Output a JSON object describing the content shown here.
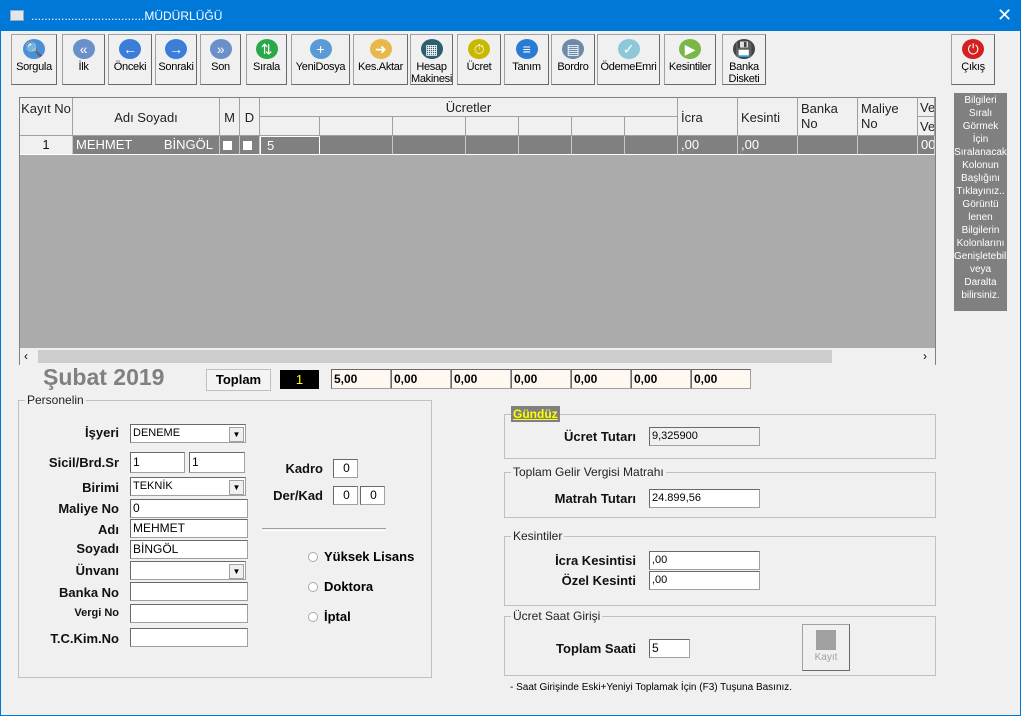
{
  "window": {
    "title": "..................................MÜDÜRLÜĞÜ",
    "close": "✕"
  },
  "toolbar": [
    {
      "label": "Sorgula",
      "icon": "search-icon",
      "glyph": "🔍",
      "color": "#4a90d9"
    },
    {
      "label": "İlk",
      "icon": "first-icon",
      "glyph": "«",
      "color": "#6b8fc9"
    },
    {
      "label": "Önceki",
      "icon": "previous-icon",
      "glyph": "←",
      "color": "#3b7dd8"
    },
    {
      "label": "Sonraki",
      "icon": "next-icon",
      "glyph": "→",
      "color": "#3b7dd8"
    },
    {
      "label": "Son",
      "icon": "last-icon",
      "glyph": "»",
      "color": "#6b8fc9"
    },
    {
      "label": "Sırala",
      "icon": "sort-icon",
      "glyph": "⇅",
      "color": "#2aa84a"
    },
    {
      "label": "YeniDosya",
      "icon": "new-folder-icon",
      "glyph": "+",
      "color": "#5b9bd5"
    },
    {
      "label": "Kes.Aktar",
      "icon": "folder-export-icon",
      "glyph": "➜",
      "color": "#e8b84a"
    },
    {
      "label": "Hesap Makinesi",
      "icon": "calculator-icon",
      "glyph": "▦",
      "color": "#2f5f6f"
    },
    {
      "label": "Ücret",
      "icon": "stopwatch-icon",
      "glyph": "⏱",
      "color": "#c9b800"
    },
    {
      "label": "Tanım",
      "icon": "definition-icon",
      "glyph": "≡",
      "color": "#2a7bd4"
    },
    {
      "label": "Bordro",
      "icon": "payroll-icon",
      "glyph": "▤",
      "color": "#6d8aa8"
    },
    {
      "label": "ÖdemeEmri",
      "icon": "payment-order-icon",
      "glyph": "✓",
      "color": "#8ec8d8"
    },
    {
      "label": "Kesintiler",
      "icon": "deductions-icon",
      "glyph": "▶",
      "color": "#7ab648"
    },
    {
      "label": "Banka Disketi",
      "icon": "floppy-disk-icon",
      "glyph": "💾",
      "color": "#444444"
    },
    {
      "label": "Çıkış",
      "icon": "power-icon",
      "glyph": "⏻",
      "color": "#d42020"
    }
  ],
  "grid": {
    "headers": {
      "kayit": "Kayıt No",
      "adi": "Adı Soyadı",
      "m": "M",
      "d": "D",
      "ucretler": "Ücretler",
      "icra": "İcra",
      "kesinti": "Kesinti",
      "banka": "Banka No",
      "maliye": "Maliye No",
      "ve1": "Ve",
      "ve2": "Ve"
    },
    "rows": [
      {
        "kayit": "1",
        "ad": "MEHMET",
        "soyad": "BİNGÖL",
        "ucret1": "5",
        "icra": ",00",
        "kesinti": ",00",
        "ve": "00"
      }
    ]
  },
  "side_info": "Bilgileri Sıralı Görmek İçin Sıralanacak Kolonun Başlığını Tıklayınız.. Görüntü lenen Bilgilerin Kolonlarını Genişletebili veya Daralta bilirsiniz.",
  "period": "Şubat  2019",
  "totals": {
    "label": "Toplam",
    "count": "1",
    "values": [
      "5,00",
      "0,00",
      "0,00",
      "0,00",
      "0,00",
      "0,00",
      "0,00"
    ]
  },
  "personel": {
    "legend": "Personelin",
    "isyeri_label": "İşyeri",
    "isyeri": "DENEME",
    "sicil_label": "Sicil/Brd.Sr",
    "sicil": "1",
    "brd": "1",
    "birimi_label": "Birimi",
    "birimi": "TEKNİK",
    "maliye_label": "Maliye No",
    "maliye": "0",
    "adi_label": "Adı",
    "adi": "MEHMET",
    "soyadi_label": "Soyadı",
    "soyadi": "BİNGÖL",
    "unvani_label": "Ünvanı",
    "unvani": "",
    "banka_label": "Banka No",
    "banka": "",
    "vergi_label": "Vergi No",
    "vergi": "",
    "tc_label": "T.C.Kim.No",
    "tc": "",
    "kadro_label": "Kadro",
    "kadro": "0",
    "derkad_label": "Der/Kad",
    "der": "0",
    "kad": "0",
    "radios": [
      "Yüksek Lisans",
      "Doktora",
      "İptal"
    ]
  },
  "gunduz": {
    "legend": "Gündüz",
    "label": "Ücret Tutarı",
    "value": "9,325900"
  },
  "matrah": {
    "legend": "Toplam Gelir Vergisi Matrahı",
    "label": "Matrah Tutarı",
    "value": "24.899,56"
  },
  "kesintiler": {
    "legend": "Kesintiler",
    "icra_label": "İcra Kesintisi",
    "icra": ",00",
    "ozel_label": "Özel Kesinti",
    "ozel": ",00"
  },
  "saat": {
    "legend": "Ücret  Saat Girişi",
    "label": "Toplam Saati",
    "value": "5",
    "save": "Kayıt"
  },
  "note": "- Saat Girişinde Eski+Yeniyi Toplamak İçin (F3) Tuşuna Basınız."
}
